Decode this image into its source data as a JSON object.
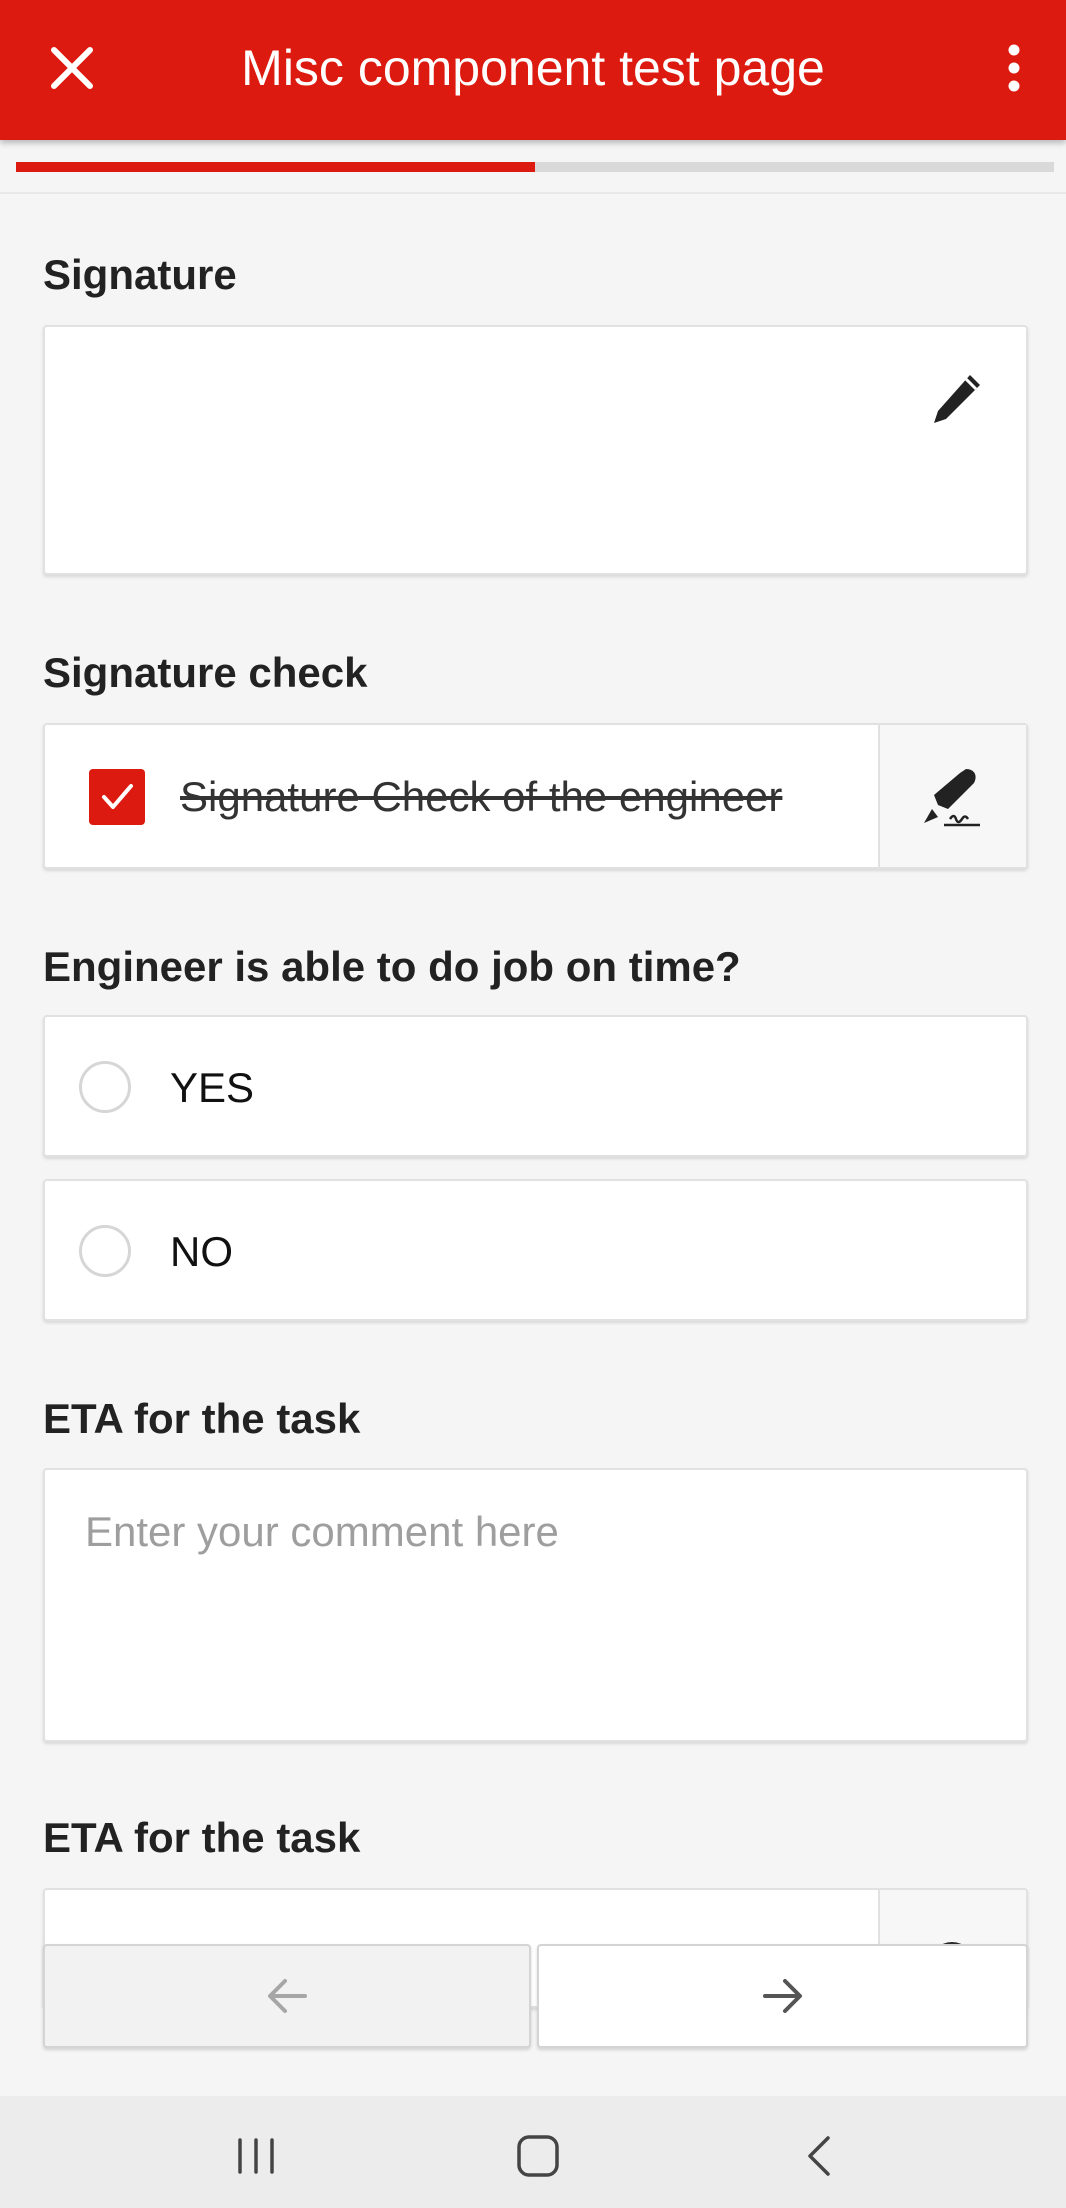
{
  "app_bar": {
    "title": "Misc component test page",
    "close_icon": "close-icon",
    "menu_icon": "more-vert-icon",
    "color": "#dd1a0f"
  },
  "progress": {
    "value": 0.5
  },
  "fields": {
    "signature": {
      "label": "Signature",
      "icon": "pencil-icon"
    },
    "signature_check": {
      "label": "Signature check",
      "checkbox_text": "Signature Check of the engineer",
      "checked": true,
      "icon": "pen-signature-icon"
    },
    "on_time": {
      "label": "Engineer is able to do job on time?",
      "options": [
        "YES",
        "NO"
      ]
    },
    "eta": {
      "label": "ETA for the task",
      "placeholder": "Enter your comment here",
      "value": ""
    },
    "eta_2": {
      "label": "ETA for the task"
    }
  },
  "navigation": {
    "prev_icon": "arrow-left-icon",
    "next_icon": "arrow-right-icon"
  },
  "system_nav": {
    "recent_icon": "recent-apps-icon",
    "home_icon": "home-icon",
    "back_icon": "back-icon"
  }
}
